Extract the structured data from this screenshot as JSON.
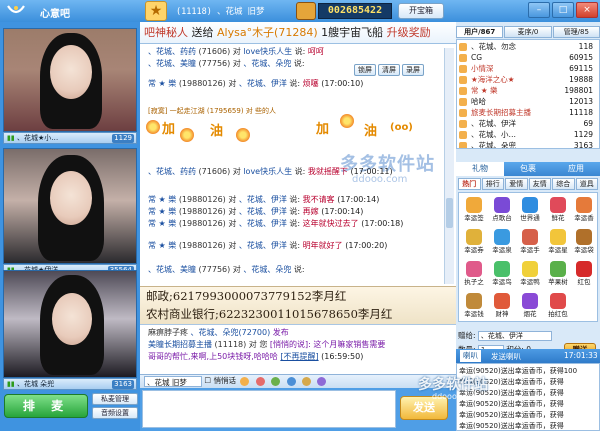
{
  "app": {
    "title": "心意吧"
  },
  "room": {
    "title": "(11118) 、花城 旧梦",
    "coins": "002685422",
    "treasure_label": "开宝箱"
  },
  "window": {
    "min": "–",
    "max": "□",
    "close": "×"
  },
  "videos": [
    {
      "name": "、花城★小…",
      "count": "1129"
    },
    {
      "name": "、花城★伊洋…",
      "count": "35564"
    },
    {
      "name": "、花城 朵兜",
      "count": "3163"
    }
  ],
  "controls": {
    "queue": "排 麦",
    "private_mgmt": "私麦管理",
    "audio_settings": "音频设置"
  },
  "ticker": {
    "a": "吧神秘人",
    "b": "送给",
    "c": "Alysa°木子(71284)",
    "d": "1艘宇宙飞船",
    "e": "升级奖励"
  },
  "chat": {
    "lines": [
      {
        "user": "、花城、药药",
        "mid": "(71606) 对",
        "to": "love快乐人生",
        "say": "说:",
        "msg": "呵呵",
        "time": ""
      },
      {
        "user": "、花城、美瞳",
        "mid": "(77756) 对",
        "to": "、花城、朵兜",
        "say": "说:",
        "msg": "",
        "time": ""
      },
      {
        "user": "常 ★ 樂",
        "mid": "(19880126) 对",
        "to": "、花城、伊洋",
        "say": "说:",
        "msg": "烦噻",
        "time": "(17:00:10)"
      },
      {
        "user": "、花城、药药",
        "mid": "(71606) 对",
        "to": "love快乐人生",
        "say": "说:",
        "msg": "我就摇醒下",
        "time": "(17:00:11)"
      },
      {
        "user": "常 ★ 樂",
        "mid": "(19880126) 对",
        "to": "、花城、伊洋",
        "say": "说:",
        "msg": "我不请客",
        "time": "(17:00:14)"
      },
      {
        "user": "常 ★ 樂",
        "mid": "(19880126) 对",
        "to": "、花城、伊洋",
        "say": "说:",
        "msg": "再嫁",
        "time": "(17:00:14)"
      },
      {
        "user": "常 ★ 樂",
        "mid": "(19880126) 对",
        "to": "、花城、伊洋",
        "say": "说:",
        "msg": "这年就快过去了",
        "time": "(17:00:18)"
      },
      {
        "user": "常 ★ 樂",
        "mid": "(19880126) 对",
        "to": "、花城、伊洋",
        "say": "说:",
        "msg": "明年就好了",
        "time": "(17:00:20)"
      },
      {
        "user": "、花城、美瞳",
        "mid": "(77756) 对",
        "to": "、花城、朵兜",
        "say": "说:",
        "msg": "",
        "time": ""
      }
    ],
    "system_line": "[寂寞] 一起走江湖 (1795659) 对 些的人",
    "emote": "(oo)",
    "watermark": "多多软件站",
    "watermark_sub": "ddooo.com"
  },
  "toolbar": {
    "lock": "锁屏",
    "clear": "清屏",
    "save": "录屏"
  },
  "bank": {
    "line1": "邮政;6217993000073779152李月红",
    "line2": "农村商业银行;6223230011015678650李月红"
  },
  "private": {
    "line1_a": "麻痹脖子疼",
    "line1_b": "、花城、朵兜(72700)",
    "line1_c": "发布",
    "line2_a": "美瞳长期招募主播",
    "line2_b": "(11118) 对 您",
    "line2_c": "[悄悄的说]: 这个月嘛家销售需要",
    "line3": "哥哥的帮忙,来啊,上50块钱呀,哈哈哈",
    "line3_b": "[不再提醒]",
    "line3_t": "(16:59:50)"
  },
  "input_bar": {
    "target": "、花城 旧梦",
    "quiet": "悄悄话"
  },
  "send": "发送",
  "user_tabs": [
    "用户/867",
    "麦序/0",
    "管理/85"
  ],
  "users": [
    {
      "name": "、花城、勿念",
      "id": "118"
    },
    {
      "name": "CG",
      "id": "60915"
    },
    {
      "name": "小情深",
      "id": "69115"
    },
    {
      "name": "★海洋之心★",
      "id": "19888"
    },
    {
      "name": "常 ★ 樂",
      "id": "198801"
    },
    {
      "name": "哈哈",
      "id": "12013"
    },
    {
      "name": "旅麦长期招募主播",
      "id": "11118"
    },
    {
      "name": "、花城、伊洋",
      "id": "69"
    },
    {
      "name": "、花城、小…",
      "id": "1129"
    },
    {
      "name": "、花城、朵兜",
      "id": "3163"
    }
  ],
  "gift_tabs": [
    "礼物",
    "包裹",
    "应用"
  ],
  "gift_subtabs": [
    "热门",
    "排行",
    "爱情",
    "友情",
    "综合",
    "道具"
  ],
  "gifts": [
    "幸运签",
    "点歌台",
    "世界通",
    "鲜花",
    "幸运香",
    "幸运券",
    "幸运泉",
    "幸运手",
    "幸运星",
    "幸运袋",
    "执子之",
    "幸运鸟",
    "幸运鸭",
    "苹果树",
    "红包",
    "幸运钱",
    "财神",
    "烟花",
    "拍红包"
  ],
  "gift_form": {
    "target_label": "赠给:",
    "target": "、花城、伊洋",
    "num_label": "数量:",
    "num": "1",
    "points_label": "积分:",
    "points": "0",
    "give": "赠送"
  },
  "notice_tabs": {
    "a": "喇叭",
    "b": "发送喇叭",
    "time": "17:01:33"
  },
  "broadcast": [
    "幸运(90520)送出幸运香币，获得100",
    "幸运(90520)送出幸运香币，获得",
    "幸运(90520)送出幸运香币，获得",
    "幸运(90520)送出幸运香币，获得",
    "幸运(90520)送出幸运香币，获得",
    "幸运(90520)送出幸运香币，获得"
  ],
  "site_logo": "多多软件站",
  "site_logo_sub": "ddooo.com"
}
